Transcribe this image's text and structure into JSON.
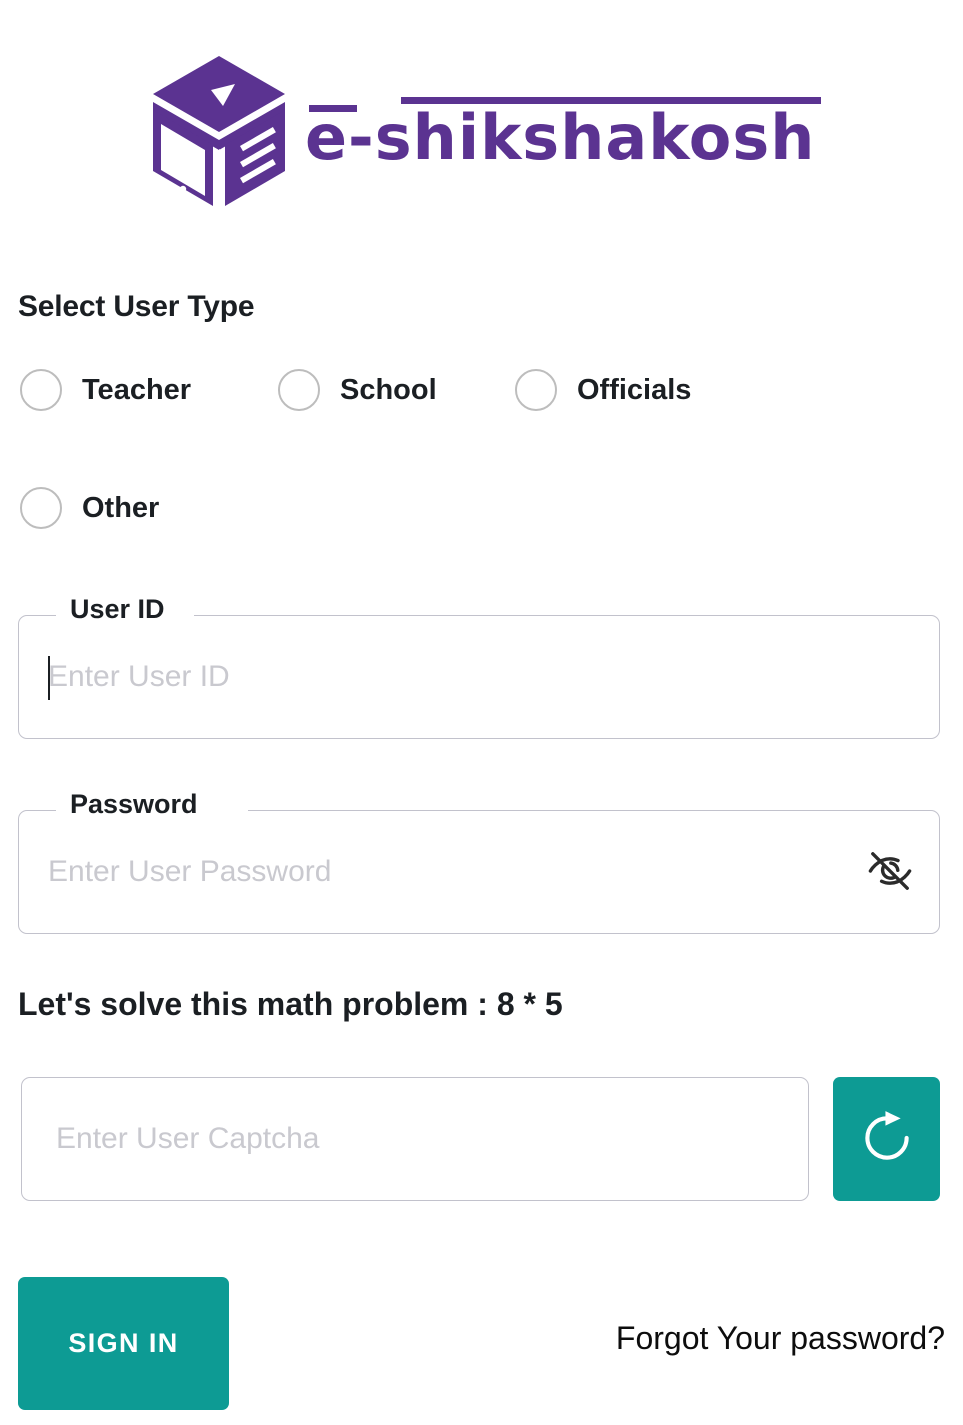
{
  "brand": {
    "logo_icon": "isometric-book-cube-icon",
    "wordmark": "e-shikshakosh",
    "purple": "#5B3391",
    "teal": "#0D9B94"
  },
  "user_type": {
    "heading": "Select User Type",
    "options": [
      {
        "label": "Teacher",
        "selected": false,
        "icon": "radio-unchecked-icon"
      },
      {
        "label": "School",
        "selected": false,
        "icon": "radio-unchecked-icon"
      },
      {
        "label": "Officials",
        "selected": false,
        "icon": "radio-unchecked-icon"
      },
      {
        "label": "Other",
        "selected": false,
        "icon": "radio-unchecked-icon"
      }
    ]
  },
  "user_id_field": {
    "legend": "User ID",
    "placeholder": "Enter User ID",
    "value": "",
    "focused": true
  },
  "password_field": {
    "legend": "Password",
    "placeholder": "Enter User Password",
    "value": "",
    "toggle_icon": "eye-off-icon"
  },
  "captcha": {
    "question": "Let's solve this math problem : 8 * 5",
    "placeholder": "Enter User Captcha",
    "value": "",
    "refresh_icon": "refresh-icon"
  },
  "actions": {
    "sign_in_label": "SIGN IN",
    "forgot_label": "Forgot Your password?"
  }
}
